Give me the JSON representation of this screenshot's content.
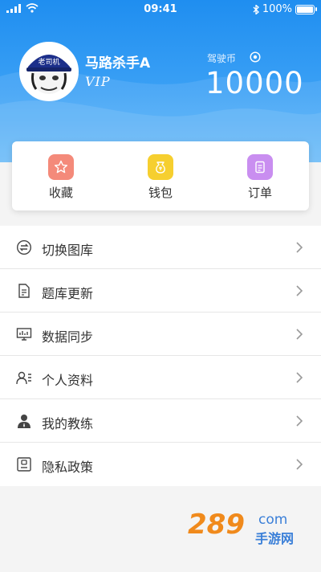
{
  "status_bar": {
    "time": "09:41",
    "battery": "100%"
  },
  "profile": {
    "name": "马路杀手A",
    "badge": "VIP",
    "avatar_cap_text": "老司机"
  },
  "coins": {
    "label": "驾驶币",
    "value": "10000"
  },
  "quick_actions": [
    {
      "label": "收藏",
      "icon": "star-icon",
      "color": "#f48a7a"
    },
    {
      "label": "钱包",
      "icon": "wallet-icon",
      "color": "#f6cf2f"
    },
    {
      "label": "订单",
      "icon": "order-icon",
      "color": "#c98ef0"
    }
  ],
  "menu": [
    {
      "label": "切换图库",
      "icon": "switch-icon"
    },
    {
      "label": "题库更新",
      "icon": "update-icon"
    },
    {
      "label": "数据同步",
      "icon": "sync-icon"
    },
    {
      "label": "个人资料",
      "icon": "profile-icon"
    },
    {
      "label": "我的教练",
      "icon": "coach-icon"
    },
    {
      "label": "隐私政策",
      "icon": "privacy-icon"
    }
  ],
  "watermark": {
    "logo": "289",
    "suffix": "com",
    "subtitle": "手游网"
  }
}
